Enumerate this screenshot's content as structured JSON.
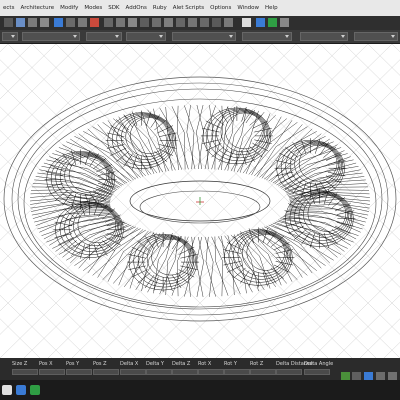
{
  "menu": {
    "items": [
      "ects",
      "Architecture",
      "Modify",
      "Modes",
      "SDK",
      "AddOns",
      "Ruby",
      "Alet Scripts",
      "Options",
      "Window",
      "Help"
    ]
  },
  "status": {
    "columns": [
      "Size Z",
      "Pos X",
      "Pos Y",
      "Pos Z",
      "Delta X",
      "Delta Y",
      "Delta Z",
      "Rot X",
      "Rot Y",
      "Rot Z",
      "Delta Distance",
      "Delta Angle"
    ]
  },
  "colors": {
    "accent": "#3a7bd5",
    "check_green": "#2f9e44",
    "menubar_bg": "#e8e8e8",
    "toolbar_bg": "#2f2f2f",
    "statusbar_bg": "#2b2b2b"
  },
  "icons": [
    "drag-handle-icon",
    "select-icon",
    "scale-icon",
    "grid-icon",
    "pan-icon",
    "stop-icon",
    "home-icon",
    "target-icon",
    "cursor-icon",
    "monitor-icon",
    "check-icon",
    "help-icon"
  ]
}
